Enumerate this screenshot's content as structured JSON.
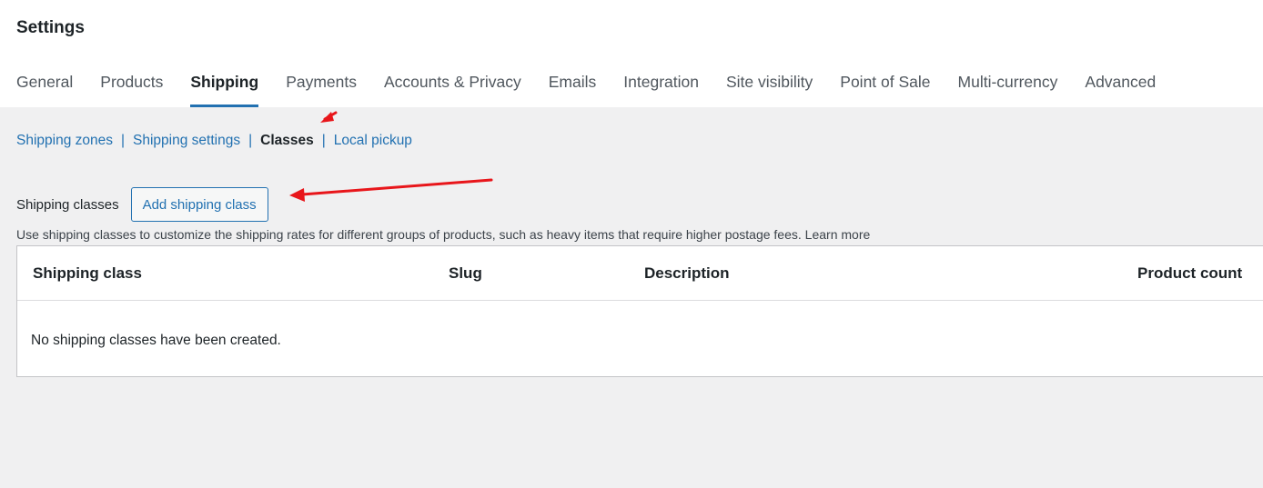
{
  "header": {
    "title": "Settings",
    "tabs": [
      {
        "label": "General"
      },
      {
        "label": "Products"
      },
      {
        "label": "Shipping",
        "active": true
      },
      {
        "label": "Payments"
      },
      {
        "label": "Accounts & Privacy"
      },
      {
        "label": "Emails"
      },
      {
        "label": "Integration"
      },
      {
        "label": "Site visibility"
      },
      {
        "label": "Point of Sale"
      },
      {
        "label": "Multi-currency"
      },
      {
        "label": "Advanced"
      }
    ]
  },
  "subnav": {
    "items": [
      "Shipping zones",
      "Shipping settings",
      "Classes",
      "Local pickup"
    ],
    "separator": "|",
    "current": "Classes"
  },
  "section": {
    "label": "Shipping classes",
    "add_button": "Add shipping class",
    "description": "Use shipping classes to customize the shipping rates for different groups of products, such as heavy items that require higher postage fees.",
    "learn_more": "Learn more"
  },
  "table": {
    "columns": [
      "Shipping class",
      "Slug",
      "Description",
      "Product count"
    ],
    "empty_message": "No shipping classes have been created."
  },
  "colors": {
    "accent": "#2271b1",
    "annotation": "#e8161b",
    "background": "#f0f0f1"
  }
}
